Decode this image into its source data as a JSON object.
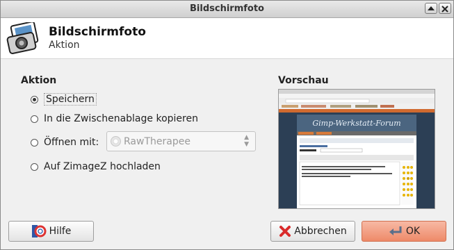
{
  "window": {
    "title": "Bildschirmfoto"
  },
  "header": {
    "title": "Bildschirmfoto",
    "subtitle": "Aktion"
  },
  "action": {
    "heading": "Aktion",
    "options": [
      {
        "label": "Speichern",
        "selected": true
      },
      {
        "label": "In die Zwischenablage kopieren",
        "selected": false
      },
      {
        "label": "Öffnen mit:",
        "selected": false
      },
      {
        "label": "Auf ZimageZ hochladen",
        "selected": false
      }
    ],
    "open_with": {
      "value": "RawTherapee"
    }
  },
  "preview": {
    "heading": "Vorschau"
  },
  "buttons": {
    "help": "Hilfe",
    "cancel": "Abbrechen",
    "ok": "OK"
  },
  "colors": {
    "ok_button": "#ee8a69",
    "cancel_icon": "#d92a2a"
  }
}
